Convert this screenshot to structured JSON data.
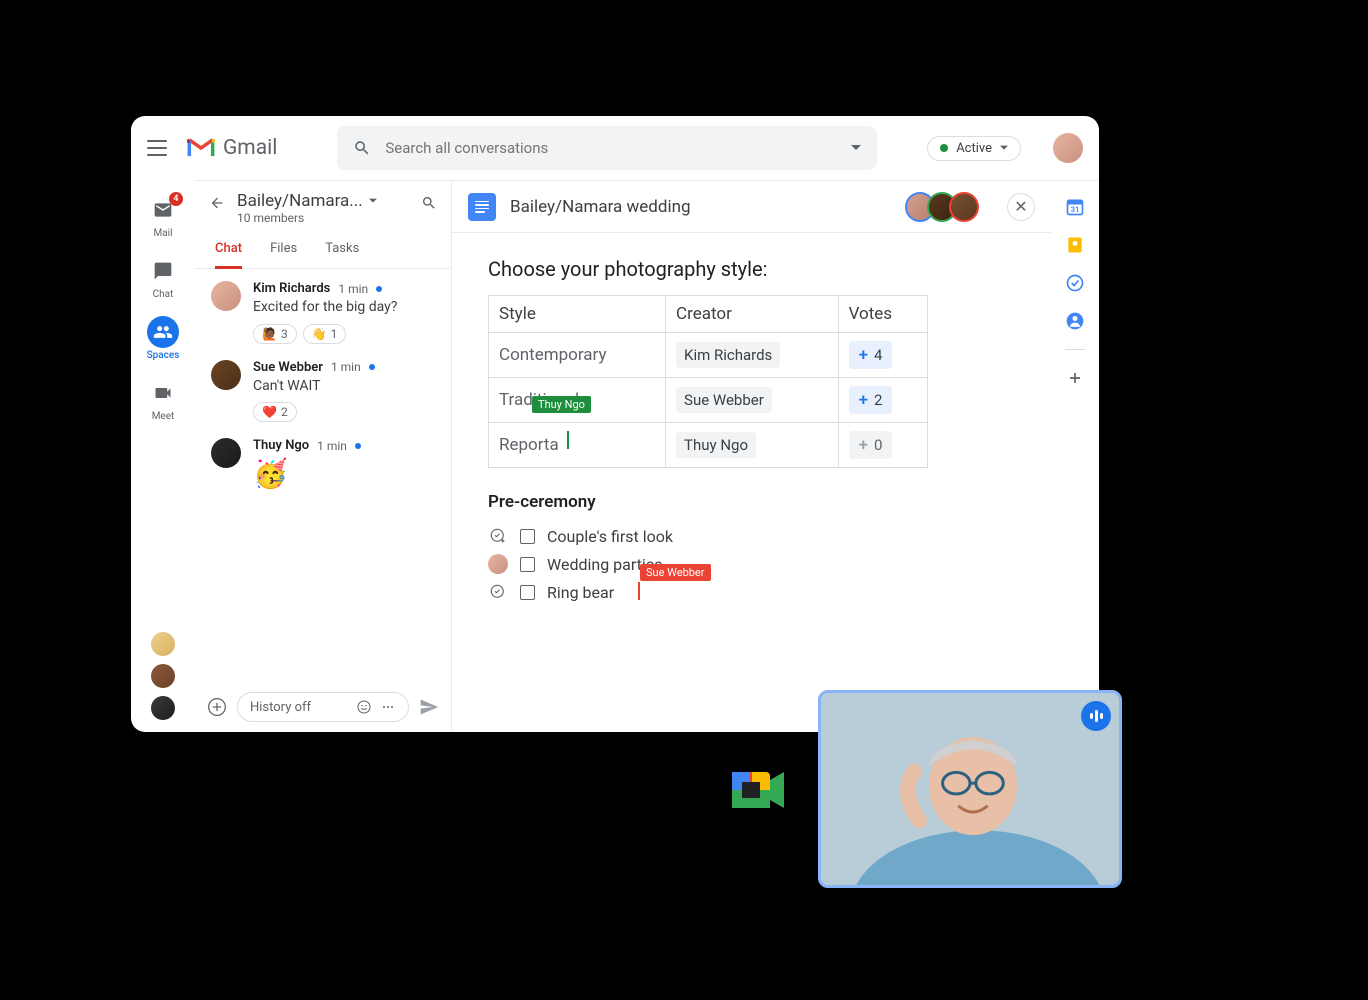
{
  "header": {
    "app_name": "Gmail",
    "search_placeholder": "Search all conversations",
    "status_label": "Active"
  },
  "nav": {
    "mail": {
      "label": "Mail",
      "badge": "4"
    },
    "chat": {
      "label": "Chat"
    },
    "spaces": {
      "label": "Spaces"
    },
    "meet": {
      "label": "Meet"
    }
  },
  "space": {
    "title": "Bailey/Namara...",
    "members": "10 members",
    "tabs": {
      "chat": "Chat",
      "files": "Files",
      "tasks": "Tasks"
    }
  },
  "messages": [
    {
      "name": "Kim Richards",
      "time": "1 min",
      "text": "Excited for the big day?",
      "reactions": [
        {
          "emoji": "🙋🏾",
          "count": "3"
        },
        {
          "emoji": "👋",
          "count": "1"
        }
      ]
    },
    {
      "name": "Sue Webber",
      "time": "1 min",
      "text": "Can't WAIT",
      "reactions": [
        {
          "emoji": "❤️",
          "count": "2"
        }
      ]
    },
    {
      "name": "Thuy Ngo",
      "time": "1 min",
      "emoji": "🥳"
    }
  ],
  "compose": {
    "placeholder": "History off"
  },
  "doc": {
    "title": "Bailey/Namara wedding",
    "heading": "Choose your photography style:",
    "table": {
      "headers": {
        "style": "Style",
        "creator": "Creator",
        "votes": "Votes"
      },
      "rows": [
        {
          "style": "Contemporary",
          "creator": "Kim Richards",
          "votes": "4",
          "active": true
        },
        {
          "style": "Traditional",
          "creator": "Sue Webber",
          "votes": "2",
          "active": true
        },
        {
          "style": "Reporta",
          "creator": "Thuy Ngo",
          "votes": "0",
          "active": false
        }
      ]
    },
    "cursors": {
      "green": "Thuy Ngo",
      "red": "Sue Webber"
    },
    "section2": "Pre-ceremony",
    "checklist": [
      {
        "text": "Couple's first look",
        "avatar": false
      },
      {
        "text": "Wedding parties",
        "avatar": true
      },
      {
        "text": "Ring bear",
        "avatar": false
      }
    ]
  }
}
